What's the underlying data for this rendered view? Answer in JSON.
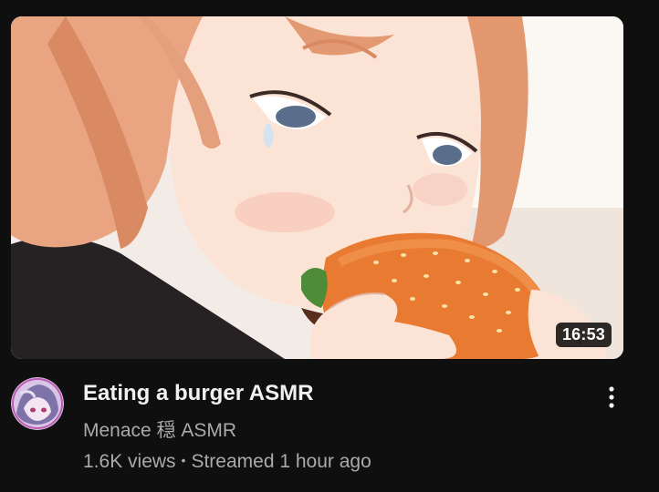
{
  "video": {
    "duration": "16:53",
    "title": "Eating a burger ASMR",
    "channel": "Menace 穏 ASMR",
    "views": "1.6K views",
    "separator": "•",
    "streamed": "Streamed 1 hour ago"
  },
  "icons": {
    "menu": "more-vert-icon",
    "avatar": "channel-avatar"
  },
  "colors": {
    "background": "#0f0f0f",
    "title": "#f1f1f1",
    "secondary_text": "#aaaaaa",
    "duration_badge": "#000000"
  }
}
